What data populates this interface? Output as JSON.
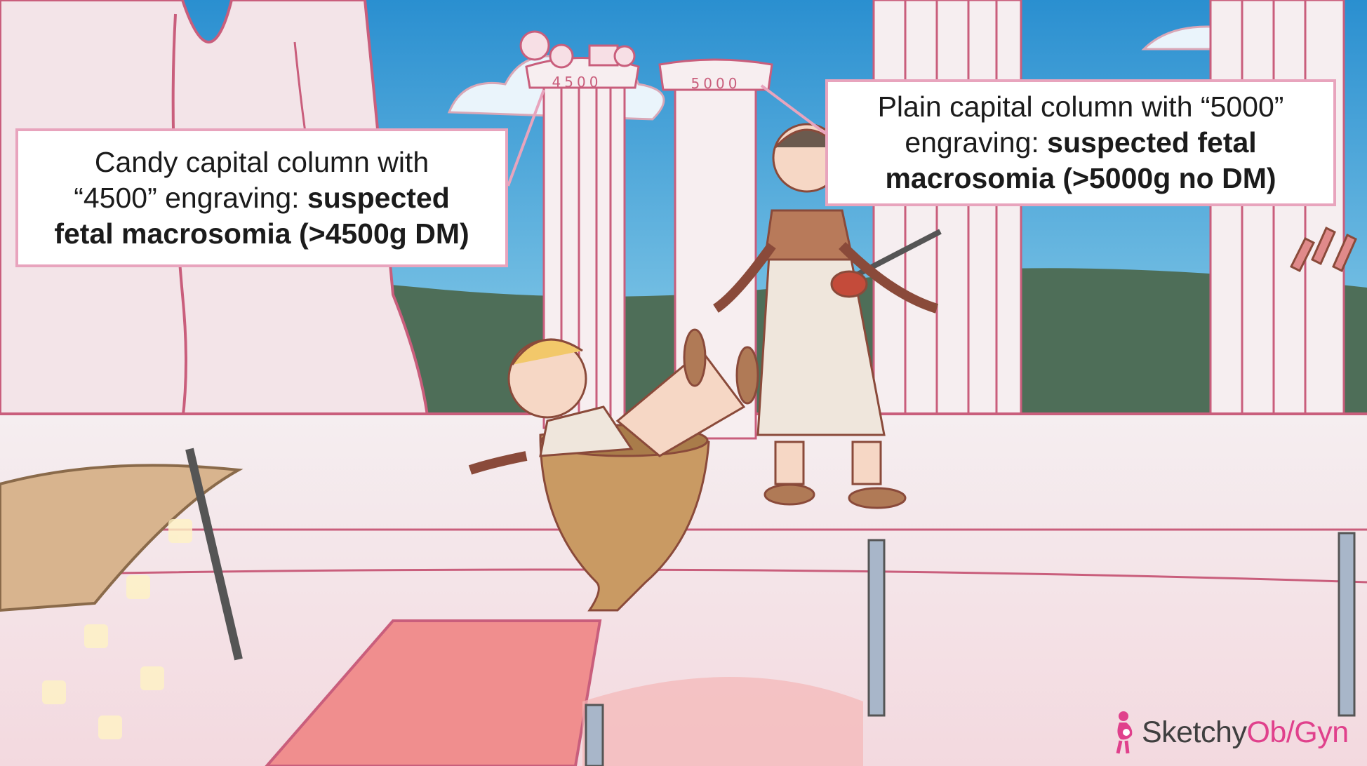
{
  "callouts": {
    "left": {
      "line1": "Candy capital column with",
      "line2_plain": "“4500” engraving: ",
      "line2_bold": "suspected",
      "line3_bold": "fetal macrosomia (>4500g DM)"
    },
    "right": {
      "line1": "Plain capital column with “5000”",
      "line2_plain": "engraving: ",
      "line2_bold": "suspected fetal",
      "line3_bold": "macrosomia (>5000g no DM)"
    }
  },
  "engravings": {
    "candy_column": "4500",
    "plain_column": "5000"
  },
  "logo": {
    "part1": "Sketchy",
    "part2": "Ob/Gyn"
  },
  "colors": {
    "sky": "#2a8fd0",
    "callout_border": "#e8a4bd",
    "brand_pink": "#e0418c",
    "hills": "#4e6e58"
  }
}
